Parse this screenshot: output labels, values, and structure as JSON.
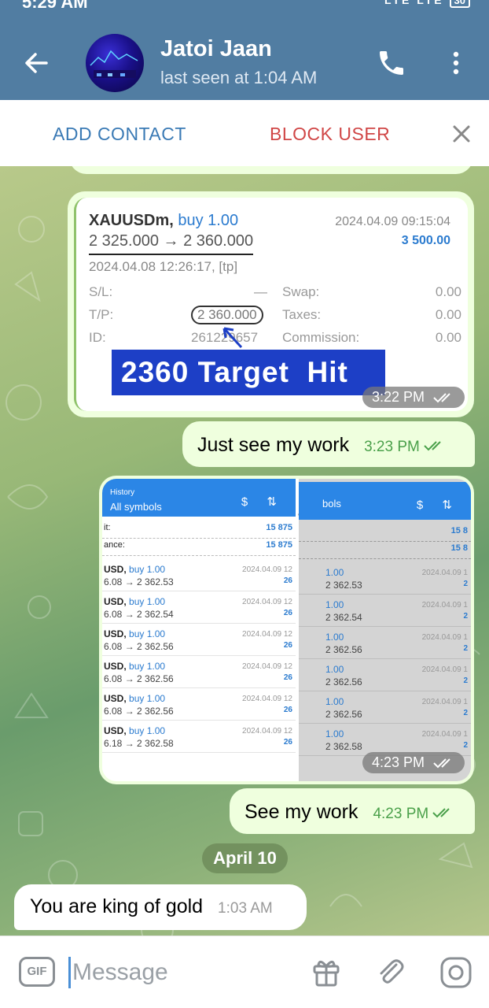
{
  "status_bar": {
    "time": "5:29 AM",
    "network": "LTE LTE",
    "battery": "30"
  },
  "header": {
    "name": "Jatoi Jaan",
    "last_seen": "last seen at 1:04 AM"
  },
  "action_bar": {
    "add_contact": "ADD CONTACT",
    "block_user": "BLOCK USER"
  },
  "messages": {
    "trade_photo": {
      "symbol": "XAUUSDm,",
      "side": "buy 1.00",
      "date": "2024.04.09 09:15:04",
      "price": "2 325.000 → 2 360.000",
      "profit": "3 500.00",
      "opened": "2024.04.08 12:26:17, [tp]",
      "rows": [
        {
          "k1": "S/L:",
          "v1": "—",
          "k2": "Swap:",
          "v2": "0.00"
        },
        {
          "k1": "T/P:",
          "v1": "2 360.000",
          "k2": "Taxes:",
          "v2": "0.00"
        },
        {
          "k1": "ID:",
          "v1": "261229657",
          "k2": "Commission:",
          "v2": "0.00"
        }
      ],
      "banner": "2360 Target  Hit",
      "time": "3:22 PM"
    },
    "just_see": {
      "text": "Just see my work",
      "time": "3:23 PM"
    },
    "history_photo": {
      "small": "History",
      "title": "All symbols",
      "right_title": "bols",
      "sum1_k": "it:",
      "sum1_v": "15 875",
      "sum2_k": "ance:",
      "sum2_v": "15 875",
      "rows": [
        {
          "sym": "USD,",
          "side": "buy 1.00",
          "range": "6.08 → 2 362.53",
          "date": "2024.04.09 12",
          "p": "26"
        },
        {
          "sym": "USD,",
          "side": "buy 1.00",
          "range": "6.08 → 2 362.54",
          "date": "2024.04.09 12",
          "p": "26"
        },
        {
          "sym": "USD,",
          "side": "buy 1.00",
          "range": "6.08 → 2 362.56",
          "date": "2024.04.09 12",
          "p": "26"
        },
        {
          "sym": "USD,",
          "side": "buy 1.00",
          "range": "6.08 → 2 362.56",
          "date": "2024.04.09 12",
          "p": "26"
        },
        {
          "sym": "USD,",
          "side": "buy 1.00",
          "range": "6.08 → 2 362.56",
          "date": "2024.04.09 12",
          "p": "26"
        },
        {
          "sym": "USD,",
          "side": "buy 1.00",
          "range": "6.18 → 2 362.58",
          "date": "2024.04.09 12",
          "p": "26"
        }
      ],
      "right_rows": [
        {
          "side": "1.00",
          "range": "2 362.53",
          "date": "2024.04.09 1",
          "p": "2"
        },
        {
          "side": "1.00",
          "range": "2 362.54",
          "date": "2024.04.09 1",
          "p": "2"
        },
        {
          "side": "1.00",
          "range": "2 362.56",
          "date": "2024.04.09 1",
          "p": "2"
        },
        {
          "side": "1.00",
          "range": "2 362.56",
          "date": "2024.04.09 1",
          "p": "2"
        },
        {
          "side": "1.00",
          "range": "2 362.56",
          "date": "2024.04.09 1",
          "p": "2"
        },
        {
          "side": "1.00",
          "range": "2 362.58",
          "date": "2024.04.09 1",
          "p": "2"
        }
      ],
      "time": "4:23 PM"
    },
    "see_my_work": {
      "text": "See my work",
      "time": "4:23 PM"
    },
    "date_divider": "April 10",
    "king": {
      "text": "You are king of gold",
      "time": "1:03 AM"
    }
  },
  "input": {
    "gif_label": "GIF",
    "placeholder": "Message"
  },
  "colors": {
    "header": "#517da2",
    "outgoing": "#efffde",
    "accent": "#3a7ab5",
    "danger": "#d04646"
  }
}
